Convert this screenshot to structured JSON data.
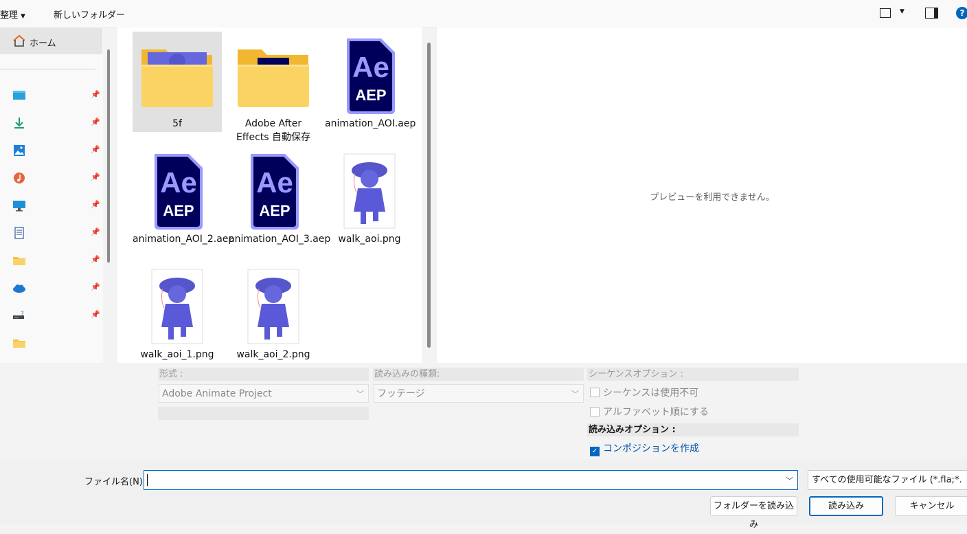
{
  "toolbar": {
    "organize_label": "整理",
    "new_folder_label": "新しいフォルダー"
  },
  "sidebar": {
    "home_label": "ホーム",
    "quick_access": [
      {
        "icon": "desktop-icon",
        "color": "#2aa0dc"
      },
      {
        "icon": "download-icon",
        "color": "#1a9c7a"
      },
      {
        "icon": "pictures-icon",
        "color": "#1e7fd8"
      },
      {
        "icon": "music-icon",
        "color": "#e8643c"
      },
      {
        "icon": "monitor-icon",
        "color": "#1e90d8"
      },
      {
        "icon": "document-icon",
        "color": "#4a6ea8"
      },
      {
        "icon": "folder-icon",
        "color": "#f2c24a"
      },
      {
        "icon": "onedrive-icon",
        "color": "#1e78d0"
      },
      {
        "icon": "network-drive-icon",
        "color": "#444444"
      },
      {
        "icon": "folder-icon",
        "color": "#f2c24a"
      }
    ]
  },
  "files": [
    {
      "name": "5f",
      "type": "folder-with-image",
      "selected": true
    },
    {
      "name": "Adobe After Effects 自動保存",
      "type": "folder-ae",
      "selected": false
    },
    {
      "name": "animation_AOI.aep",
      "type": "aep",
      "selected": false
    },
    {
      "name": "animation_AOI_2.aep",
      "type": "aep",
      "selected": false
    },
    {
      "name": "animation_AOI_3.aep",
      "type": "aep",
      "selected": false
    },
    {
      "name": "walk_aoi.png",
      "type": "png",
      "selected": false
    },
    {
      "name": "walk_aoi_1.png",
      "type": "png",
      "selected": false
    },
    {
      "name": "walk_aoi_2.png",
      "type": "png",
      "selected": false
    }
  ],
  "aep_icon": {
    "line1": "Ae",
    "line2": "AEP"
  },
  "preview": {
    "message": "プレビューを利用できません。"
  },
  "options": {
    "format_label": "形式 :",
    "format_value": "Adobe Animate Project",
    "import_type_label": "読み込みの種類:",
    "import_type_value": "フッテージ",
    "sequence_label": "シーケンスオプション :",
    "sequence_unavailable": "シーケンスは使用不可",
    "alphabetical": "アルファベット順にする",
    "import_options_label": "読み込みオプション :",
    "create_composition": "コンポジションを作成"
  },
  "bottom": {
    "filename_label": "ファイル名(N):",
    "filename_value": "",
    "file_type": "すべての使用可能なファイル (*.fla;*.",
    "import_folder_button": "フォルダーを読み込み",
    "import_button": "読み込み",
    "cancel_button": "キャンセル"
  }
}
